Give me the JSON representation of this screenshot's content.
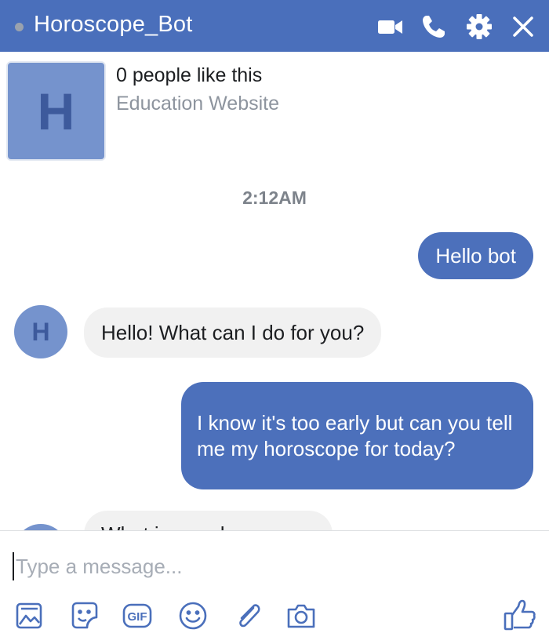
{
  "header": {
    "title": "Horoscope_Bot",
    "status_color": "#9aa2ae",
    "icons": [
      "video-call-icon",
      "phone-call-icon",
      "settings-gear-icon",
      "close-icon"
    ]
  },
  "page_info": {
    "avatar_letter": "H",
    "likes": "0 people like this",
    "category": "Education Website"
  },
  "conversation": {
    "timestamp": "2:12AM",
    "messages": [
      {
        "sender": "user",
        "text": "Hello bot"
      },
      {
        "sender": "bot",
        "avatar_letter": "H",
        "text": "Hello! What can I do for you?"
      },
      {
        "sender": "user",
        "text": "I know it's too early but can you tell me my horoscope for today?"
      },
      {
        "sender": "bot",
        "text": "What is your horoscope"
      }
    ]
  },
  "composer": {
    "placeholder": "Type a message...",
    "tools": [
      "photo-icon",
      "sticker-icon",
      "gif-icon",
      "emoji-icon",
      "attachment-icon",
      "camera-icon"
    ],
    "send_icon": "thumbs-up-icon"
  },
  "colors": {
    "brand": "#4a6fbb",
    "outgoing_bubble": "#4c70bb",
    "incoming_bubble": "#f1f1f1",
    "avatar": "#7593cd"
  }
}
